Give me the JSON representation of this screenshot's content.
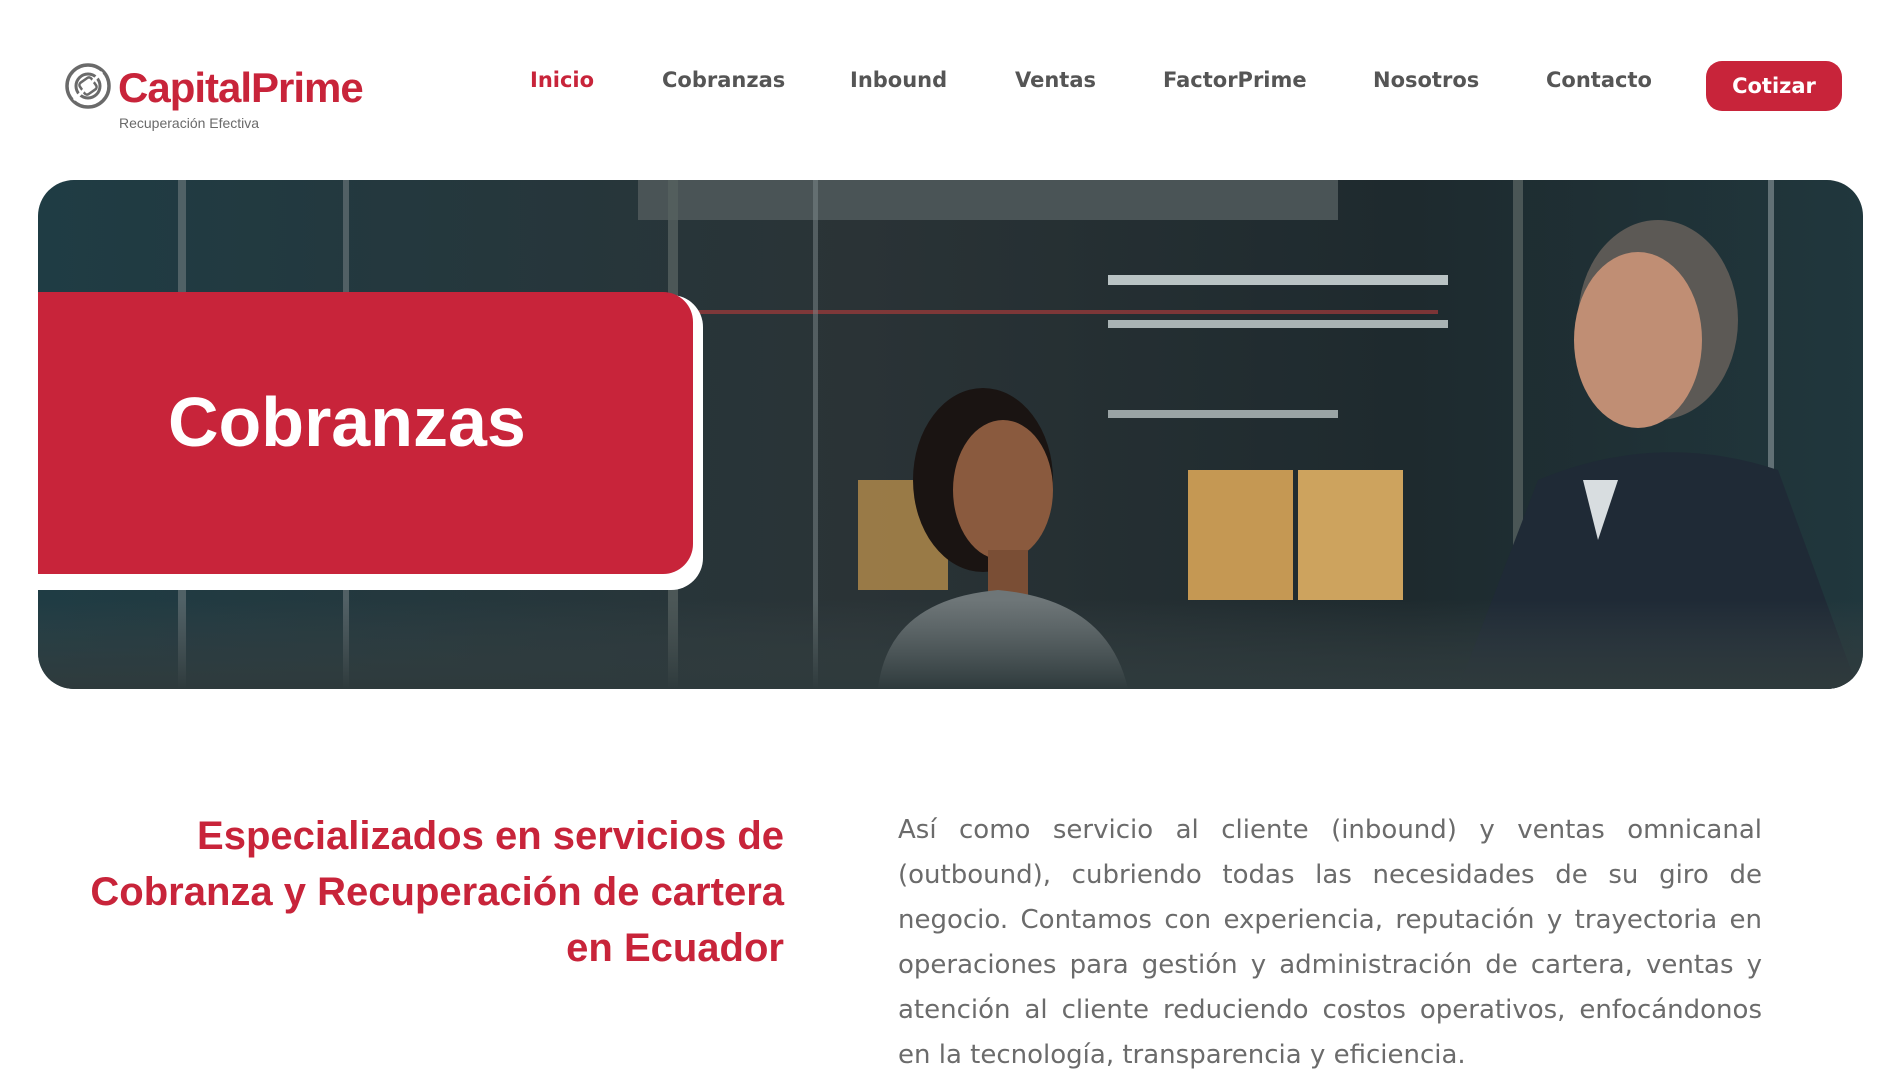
{
  "brand": {
    "name": "CapitalPrime",
    "tagline": "Recuperación Efectiva",
    "accent_color": "#c8243a",
    "logo_icon": "capitalprime-logo-icon"
  },
  "nav": {
    "items": [
      {
        "label": "Inicio",
        "active": true
      },
      {
        "label": "Cobranzas",
        "active": false
      },
      {
        "label": "Inbound",
        "active": false
      },
      {
        "label": "Ventas",
        "active": false
      },
      {
        "label": "FactorPrime",
        "active": false
      },
      {
        "label": "Nosotros",
        "active": false
      },
      {
        "label": "Contacto",
        "active": false
      }
    ],
    "cta_label": "Cotizar"
  },
  "hero": {
    "title": "Cobranzas",
    "image": "office-photo-woman-and-man-talking"
  },
  "intro": {
    "headline": "Especializados en servicios de Cobranza y Recuperación de cartera en Ecuador",
    "body": "Así como servicio al cliente (inbound) y ventas omnicanal (outbound), cubriendo todas las necesidades de su giro de negocio. Contamos con experiencia, reputación y trayectoria en operaciones para gestión y administración de cartera, ventas y atención al cliente reduciendo costos operativos, enfocándonos en la tecnología, transparencia y eficiencia."
  }
}
